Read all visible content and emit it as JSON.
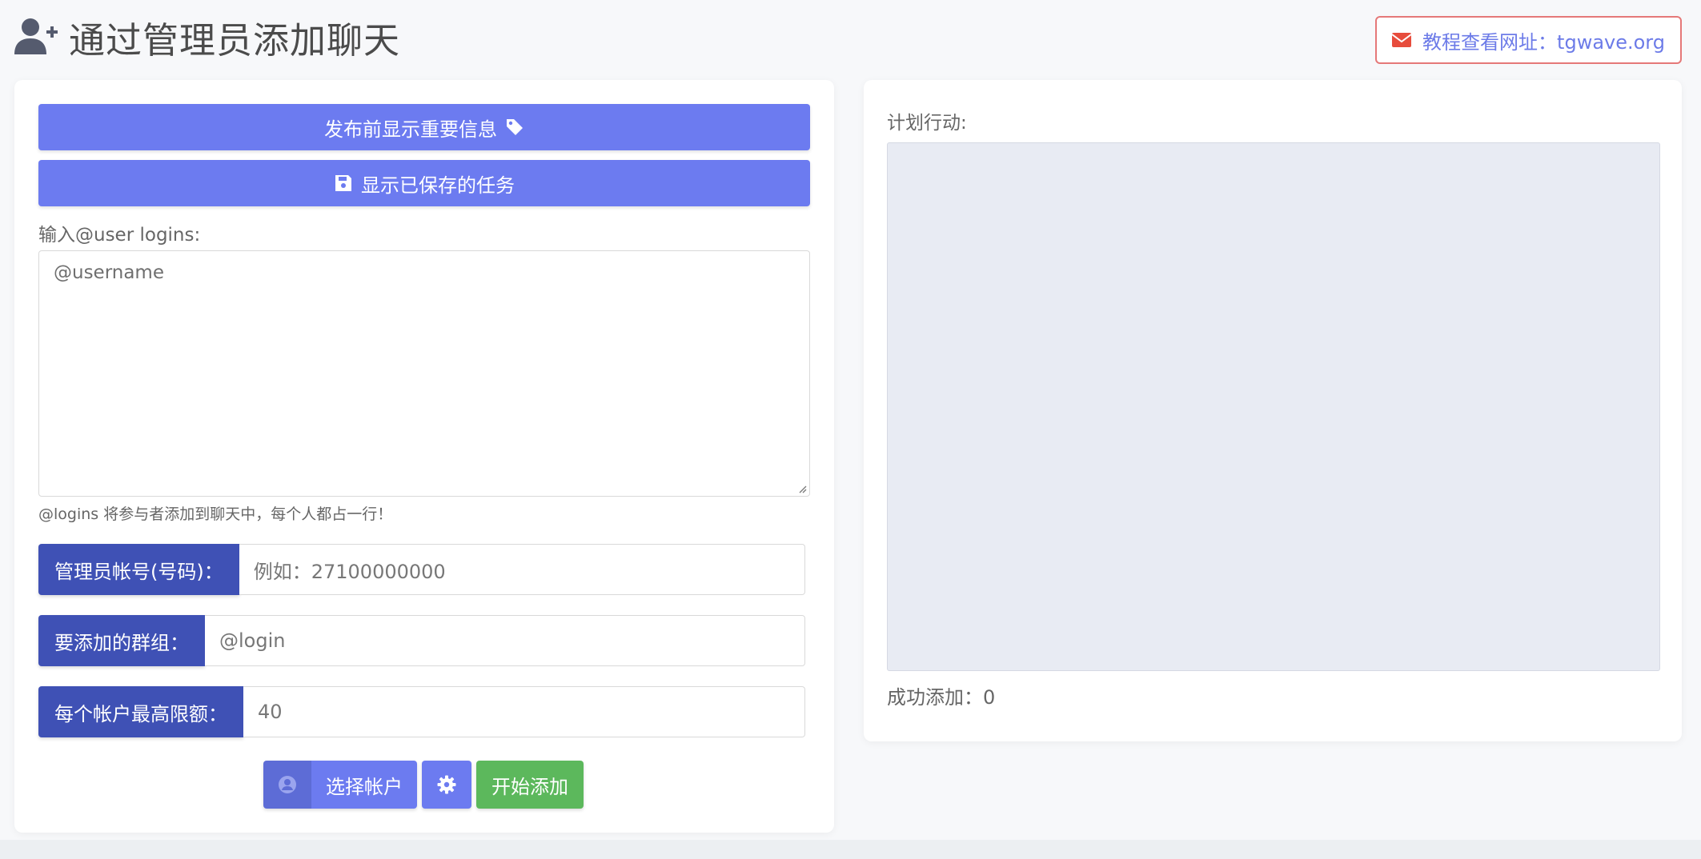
{
  "header": {
    "title": "通过管理员添加聊天",
    "icon": "user-plus-icon",
    "tutorial_label": "教程查看网址：tgwave.org",
    "tutorial_icon": "envelope-icon",
    "tutorial_border_color": "#e57878",
    "tutorial_text_color": "#6c7be8"
  },
  "left_panel": {
    "show_info_button": {
      "label": "发布前显示重要信息",
      "icon": "tag-icon"
    },
    "saved_tasks_button": {
      "label": "显示已保存的任务",
      "icon": "save-icon"
    },
    "logins_label": "输入@user logins:",
    "logins_placeholder": "@username",
    "logins_hint": "@logins 将参与者添加到聊天中，每个人都占一行！",
    "fields": [
      {
        "label": "管理员帐号(号码)：",
        "value": "例如：27100000000"
      },
      {
        "label": "要添加的群组：",
        "value": "@login"
      },
      {
        "label": "每个帐户最高限额：",
        "value": "40"
      }
    ],
    "buttons": {
      "select_account": "选择帐户",
      "select_account_icon": "user-circle-icon",
      "settings_icon": "gear-icon",
      "start": "开始添加"
    }
  },
  "right_panel": {
    "plan_label": "计划行动:",
    "success_label": "成功添加：0"
  },
  "colors": {
    "primary": "#6c7bf0",
    "addon": "#3f51b5",
    "success": "#5cb85c"
  }
}
